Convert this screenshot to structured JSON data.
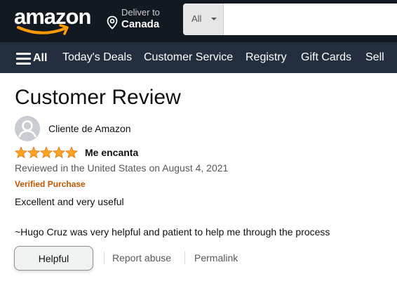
{
  "header": {
    "logo_text": "amazon",
    "deliver_line1": "Deliver to",
    "deliver_line2": "Canada",
    "search_category": "All",
    "search_value": "",
    "search_placeholder": ""
  },
  "nav": {
    "all_label": "All",
    "links": [
      "Today's Deals",
      "Customer Service",
      "Registry",
      "Gift Cards",
      "Sell"
    ]
  },
  "review": {
    "page_title": "Customer Review",
    "reviewer_name": "Cliente de Amazon",
    "rating": 5,
    "rating_max": 5,
    "title": "Me encanta",
    "date_text": "Reviewed in the United States on August 4, 2021",
    "verified_label": "Verified Purchase",
    "body_line1": "Excellent and very useful",
    "body_line2": "~Hugo Cruz was very helpful and patient to help me through the process"
  },
  "actions": {
    "helpful_label": "Helpful",
    "report_label": "Report abuse",
    "permalink_label": "Permalink"
  },
  "colors": {
    "header_bg": "#131921",
    "nav_bg": "#232f3e",
    "logo_smile": "#ff9900",
    "star": "#ffa41c",
    "verified": "#c45500"
  },
  "icons": {
    "location": "location-pin-icon",
    "menu": "hamburger-menu-icon",
    "avatar": "default-avatar-icon",
    "star": "star-icon",
    "caret": "caret-down-icon"
  }
}
